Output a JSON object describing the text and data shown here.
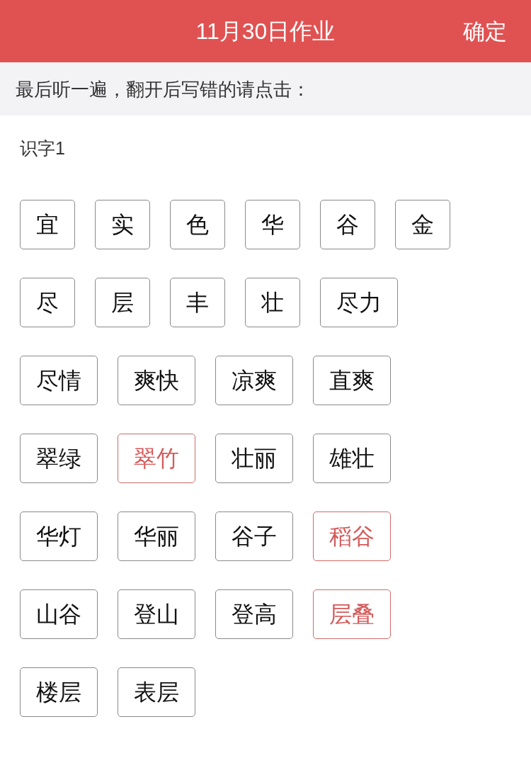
{
  "header": {
    "title": "11月30日作业",
    "confirm_button": "确定"
  },
  "instruction": "最后听一遍，翻开后写错的请点击：",
  "section": {
    "title": "识字1",
    "items": [
      {
        "label": "宜",
        "selected": false
      },
      {
        "label": "实",
        "selected": false
      },
      {
        "label": "色",
        "selected": false
      },
      {
        "label": "华",
        "selected": false
      },
      {
        "label": "谷",
        "selected": false
      },
      {
        "label": "金",
        "selected": false
      },
      {
        "label": "尽",
        "selected": false
      },
      {
        "label": "层",
        "selected": false
      },
      {
        "label": "丰",
        "selected": false
      },
      {
        "label": "壮",
        "selected": false
      },
      {
        "label": "尽力",
        "selected": false
      },
      {
        "label": "尽情",
        "selected": false
      },
      {
        "label": "爽快",
        "selected": false
      },
      {
        "label": "凉爽",
        "selected": false
      },
      {
        "label": "直爽",
        "selected": false
      },
      {
        "label": "翠绿",
        "selected": false
      },
      {
        "label": "翠竹",
        "selected": true
      },
      {
        "label": "壮丽",
        "selected": false
      },
      {
        "label": "雄壮",
        "selected": false
      },
      {
        "label": "华灯",
        "selected": false
      },
      {
        "label": "华丽",
        "selected": false
      },
      {
        "label": "谷子",
        "selected": false
      },
      {
        "label": "稻谷",
        "selected": true
      },
      {
        "label": "山谷",
        "selected": false
      },
      {
        "label": "登山",
        "selected": false
      },
      {
        "label": "登高",
        "selected": false
      },
      {
        "label": "层叠",
        "selected": true
      },
      {
        "label": "楼层",
        "selected": false
      },
      {
        "label": "表层",
        "selected": false
      }
    ]
  }
}
